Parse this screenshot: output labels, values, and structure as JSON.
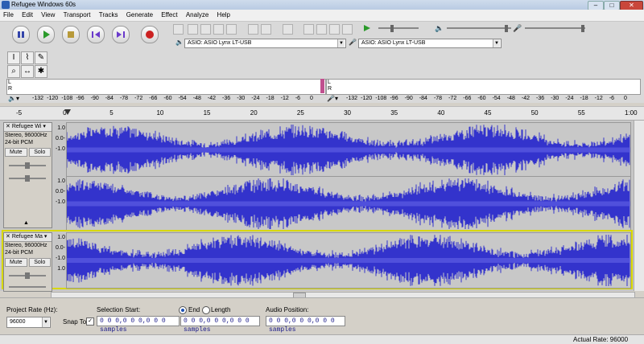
{
  "window": {
    "title": "Refugee Windows 60s"
  },
  "menu": [
    "File",
    "Edit",
    "View",
    "Transport",
    "Tracks",
    "Generate",
    "Effect",
    "Analyze",
    "Help"
  ],
  "transport": [
    "pause",
    "play",
    "stop",
    "skip-to-start",
    "skip-to-end",
    "record"
  ],
  "devices": {
    "playback": "ASIO: ASIO Lynx LT-USB",
    "recording": "ASIO: ASIO Lynx LT-USB"
  },
  "meter": {
    "channels": [
      "L",
      "R"
    ],
    "ticks_left": [
      "-132",
      "-120",
      "-108",
      "-96",
      "-90",
      "-84",
      "-78",
      "-72",
      "-66",
      "-60",
      "-54",
      "-48",
      "-42",
      "-36",
      "-30",
      "-24",
      "-18",
      "-12",
      "-6",
      "0"
    ],
    "ticks_right": [
      "-132",
      "-120",
      "-108",
      "-96",
      "-90",
      "-84",
      "-78",
      "-72",
      "-66",
      "-60",
      "-54",
      "-48",
      "-42",
      "-36",
      "-30",
      "-24",
      "-18",
      "-12",
      "-6",
      "0"
    ]
  },
  "timeline": {
    "labels": [
      "-5",
      "0",
      "5",
      "10",
      "15",
      "20",
      "25",
      "30",
      "35",
      "40",
      "45",
      "50",
      "55",
      "1:00"
    ]
  },
  "tracks": [
    {
      "name": "Refugee Wi",
      "format": "Stereo, 96000Hz",
      "depth": "24-bit PCM",
      "mute": "Mute",
      "solo": "Solo",
      "scale": [
        "1.0",
        "0.0-",
        "-1.0",
        "1.0",
        "0.0-",
        "-1.0"
      ]
    },
    {
      "name": "Refugee Ma",
      "format": "Stereo, 96000Hz",
      "depth": "24-bit PCM",
      "mute": "Mute",
      "solo": "Solo",
      "scale": [
        "1.0",
        "0.0-",
        "-1.0",
        "1.0"
      ]
    }
  ],
  "selection": {
    "project_rate_label": "Project Rate (Hz):",
    "project_rate": "96000",
    "snap_label": "Snap To",
    "sel_start_label": "Selection Start:",
    "end_label": "End",
    "length_label": "Length",
    "audio_pos_label": "Audio Position:",
    "start_value": "0 0 0,0 0 0,0 0 0 samples",
    "end_value": "0 0 0,0 0 0,0 0 0 samples",
    "pos_value": "0 0 0,0 0 0,0 0 0 samples"
  },
  "status": {
    "actual_rate": "Actual Rate: 96000"
  },
  "colors": {
    "wave": "#3333cc",
    "wave_core": "#6464e6",
    "selected_border": "#d8d800"
  }
}
